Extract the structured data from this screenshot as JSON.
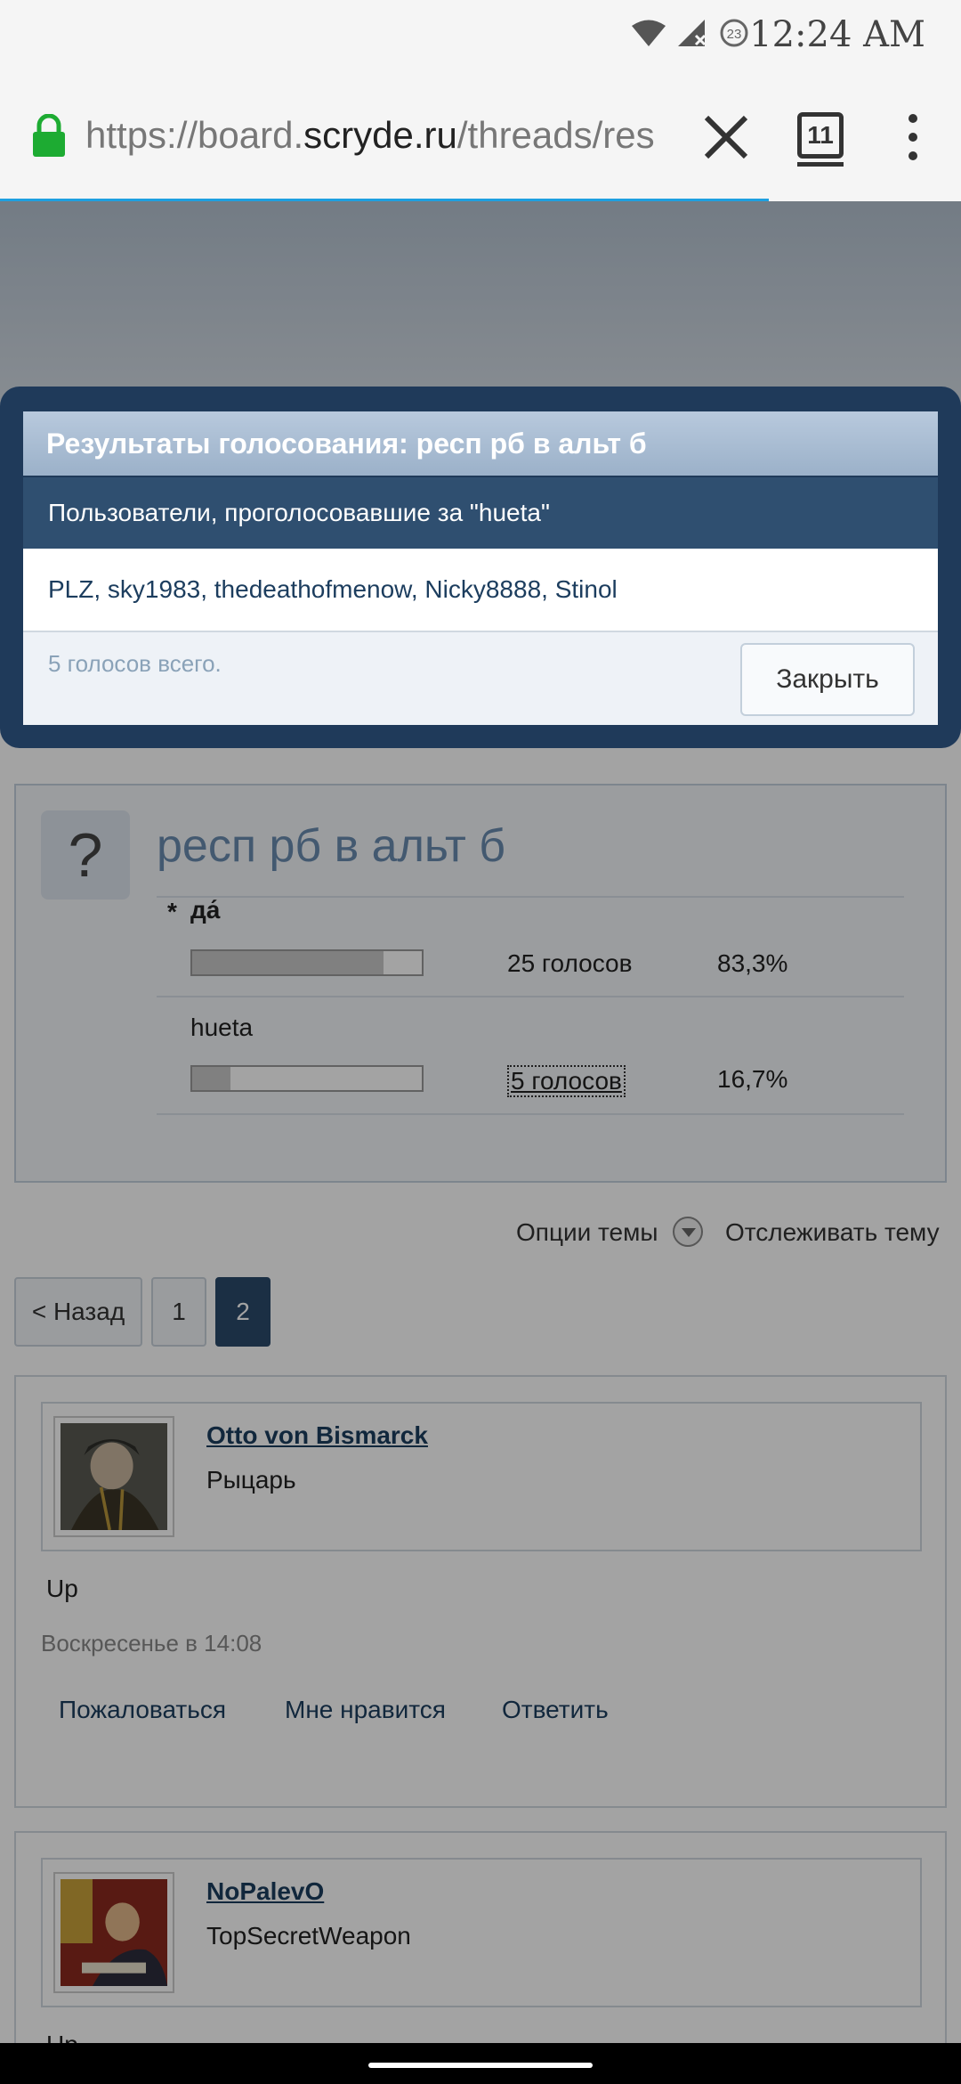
{
  "status_bar": {
    "time": "12:24 AM",
    "notification_count": "23"
  },
  "browser": {
    "url_scheme": "https://board.",
    "url_host": "scryde.ru",
    "url_path": "/threads/res",
    "tab_count": "11",
    "load_progress": 0.8
  },
  "poll": {
    "title": "респ рб в альт б",
    "options": [
      {
        "label": "да́",
        "votes": "25 голосов",
        "percent": "83,3%",
        "fraction": 0.833
      },
      {
        "label": "hueta",
        "votes": "5 голосов",
        "percent": "16,7%",
        "fraction": 0.167
      }
    ]
  },
  "thread_tools": {
    "options_label": "Опции темы",
    "watch_label": "Отслеживать тему"
  },
  "pager": {
    "prev": "< Назад",
    "pages": [
      "1",
      "2"
    ],
    "current": "2"
  },
  "posts": [
    {
      "username": "Otto von Bismarck",
      "title": "Рыцарь",
      "body": "Up",
      "date": "Воскресенье в 14:08",
      "actions": [
        "Пожаловаться",
        "Мне нравится",
        "Ответить"
      ]
    },
    {
      "username": "NoPalevO",
      "title": "TopSecretWeapon",
      "body": "Up"
    }
  ],
  "modal": {
    "title": "Результаты голосования: респ рб в альт б",
    "subtitle": "Пользователи, проголосовавшие за \"hueta\"",
    "users": [
      "PLZ",
      "sky1983",
      "thedeathofmenow",
      "Nicky8888",
      "Stinol"
    ],
    "total": "5 голосов всего.",
    "close_label": "Закрыть"
  }
}
